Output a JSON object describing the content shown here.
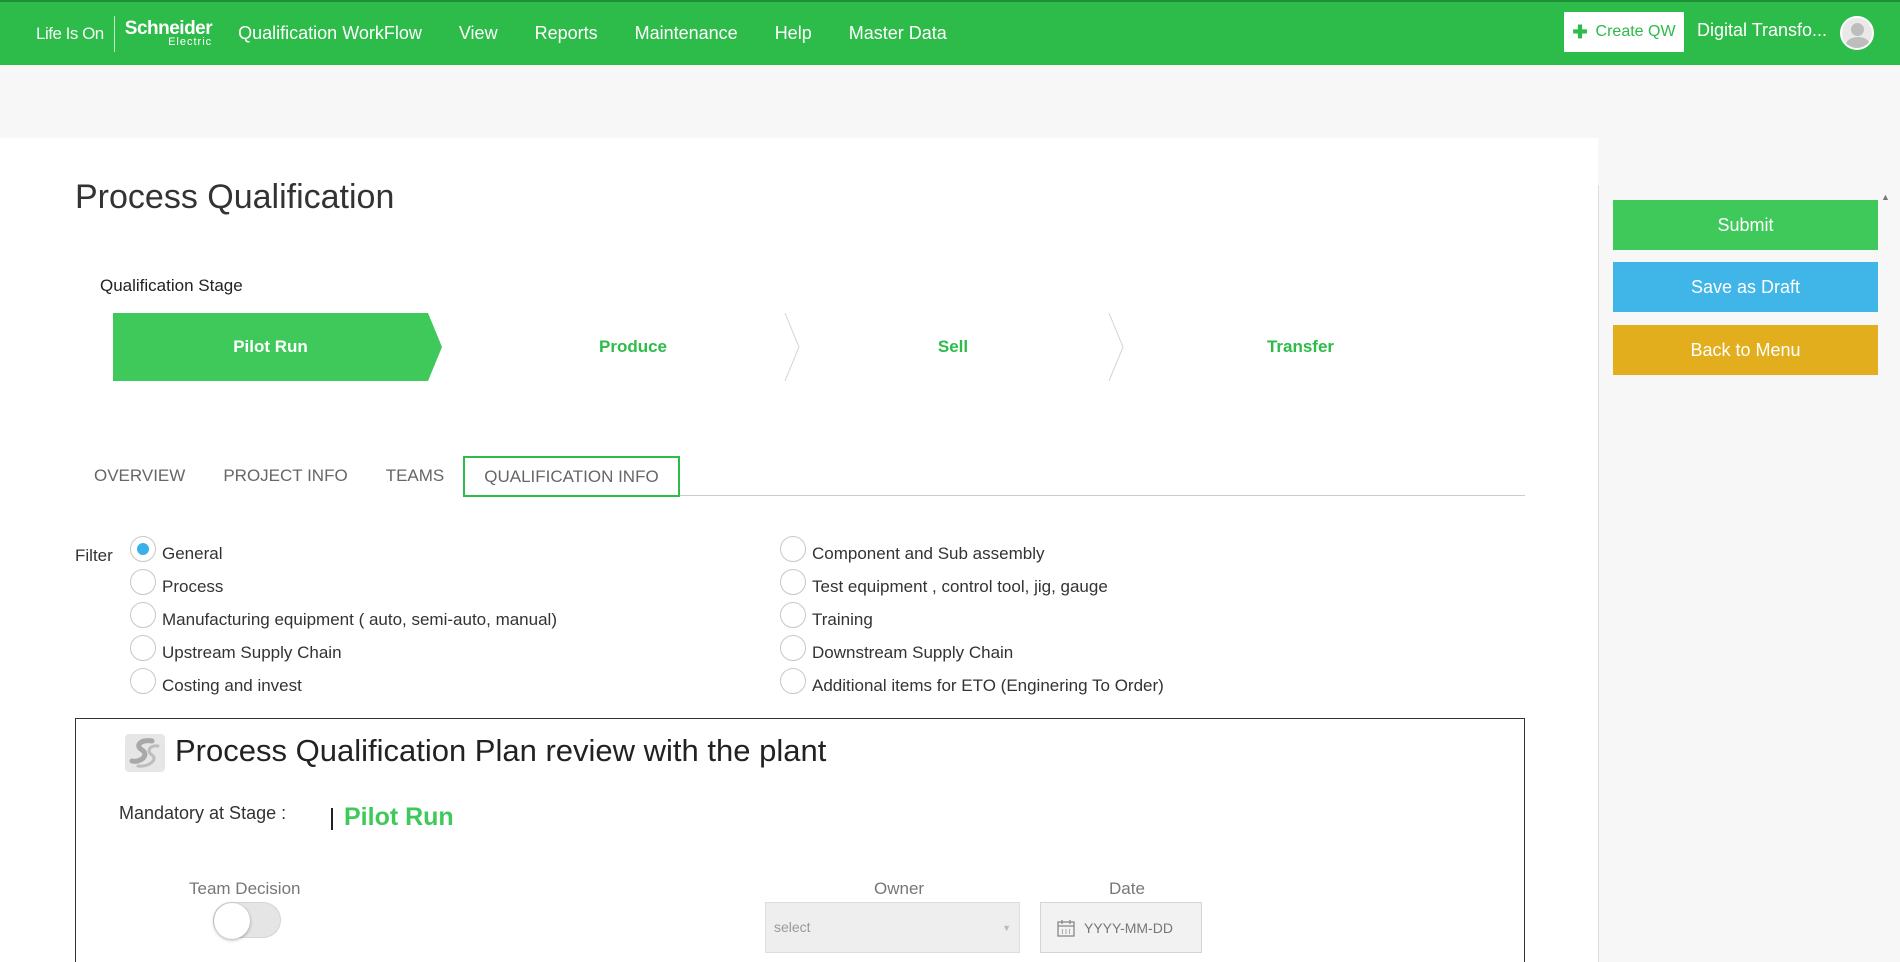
{
  "header": {
    "logo_tagline": "Life Is On",
    "logo_brand": "Schneider",
    "logo_sub": "Electric",
    "nav": [
      "Qualification WorkFlow",
      "View",
      "Reports",
      "Maintenance",
      "Help",
      "Master Data"
    ],
    "create_label": "Create QW",
    "user_name": "Digital Transfo..."
  },
  "page": {
    "title": "Process Qualification",
    "stage_label": "Qualification Stage",
    "stages": [
      "Pilot Run",
      "Produce",
      "Sell",
      "Transfer"
    ],
    "tabs": [
      "OVERVIEW",
      "PROJECT INFO",
      "TEAMS",
      "QUALIFICATION INFO"
    ],
    "filter_label": "Filter",
    "filters_left": [
      "General",
      "Process",
      "Manufacturing equipment ( auto, semi-auto, manual)",
      "Upstream Supply Chain",
      "Costing and invest"
    ],
    "filters_right": [
      "Component and Sub assembly",
      "Test equipment , control tool, jig, gauge",
      "Training",
      "Downstream Supply Chain",
      "Additional items for ETO (Enginering To Order)"
    ],
    "selected_filter": "General"
  },
  "card": {
    "title": "Process Qualification Plan review with the plant",
    "mandatory_label": "Mandatory at Stage :",
    "mandatory_value": "Pilot Run",
    "team_decision_label": "Team Decision",
    "owner_label": "Owner",
    "owner_placeholder": "select",
    "date_label": "Date",
    "date_placeholder": "YYYY-MM-DD"
  },
  "actions": {
    "submit": "Submit",
    "save_draft": "Save as Draft",
    "back": "Back to Menu"
  },
  "colors": {
    "brand_green": "#2dbb49",
    "accent_green": "#3ec95a",
    "draft_blue": "#40b5e8",
    "back_yellow": "#e2ae1e"
  }
}
